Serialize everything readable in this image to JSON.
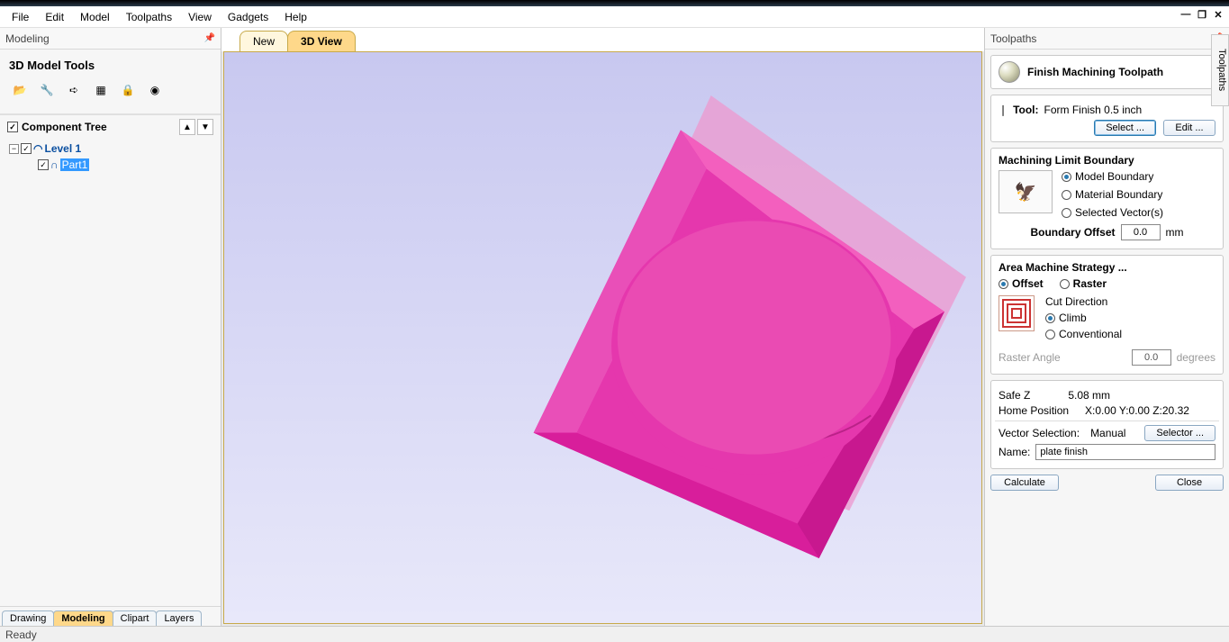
{
  "menubar": [
    "File",
    "Edit",
    "Model",
    "Toolpaths",
    "View",
    "Gadgets",
    "Help"
  ],
  "left": {
    "panel_title": "Modeling",
    "section_title": "3D Model Tools",
    "comp_tree_title": "Component Tree",
    "tree": {
      "level": "Level 1",
      "part": "Part1"
    },
    "bottom_tabs": [
      "Drawing",
      "Modeling",
      "Clipart",
      "Layers"
    ],
    "active_bottom_tab": "Modeling"
  },
  "view_tabs": {
    "new": "New",
    "threeD": "3D View"
  },
  "right": {
    "panel_title": "Toolpaths",
    "toolpath_title": "Finish Machining Toolpath",
    "tool_label": "Tool:",
    "tool_value": "Form Finish 0.5 inch",
    "select_btn": "Select ...",
    "edit_btn": "Edit ...",
    "limit_title": "Machining Limit Boundary",
    "limit_opts": [
      "Model Boundary",
      "Material Boundary",
      "Selected Vector(s)"
    ],
    "boundary_offset_label": "Boundary Offset",
    "boundary_offset_value": "0.0",
    "boundary_offset_unit": "mm",
    "strategy_title": "Area Machine Strategy ...",
    "strategy_offset": "Offset",
    "strategy_raster": "Raster",
    "cut_dir_label": "Cut Direction",
    "cut_dir_climb": "Climb",
    "cut_dir_conv": "Conventional",
    "raster_angle_label": "Raster Angle",
    "raster_angle_value": "0.0",
    "raster_angle_unit": "degrees",
    "safe_z_label": "Safe Z",
    "safe_z_value": "5.08 mm",
    "home_label": "Home Position",
    "home_value": "X:0.00 Y:0.00 Z:20.32",
    "vector_sel_label": "Vector Selection:",
    "vector_sel_value": "Manual",
    "selector_btn": "Selector ...",
    "name_label": "Name:",
    "name_value": "plate finish",
    "calc_btn": "Calculate",
    "close_btn": "Close",
    "side_tab": "Toolpaths"
  },
  "status": "Ready"
}
